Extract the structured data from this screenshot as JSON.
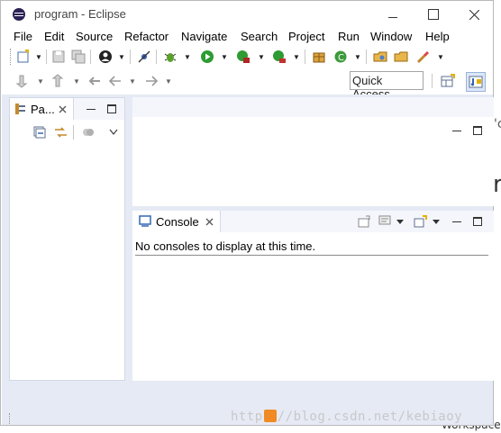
{
  "window": {
    "title": "program - Eclipse"
  },
  "menu": [
    "File",
    "Edit",
    "Source",
    "Refactor",
    "Navigate",
    "Search",
    "Project",
    "Run",
    "Window",
    "Help"
  ],
  "toolbar": {
    "quick_access": "Quick Access"
  },
  "left_view": {
    "tab_label": "Pa..."
  },
  "console": {
    "tab_label": "Console",
    "message": "No consoles to display at this time."
  },
  "background": {
    "watermark_prefix": "http",
    "watermark_suffix": "//blog.csdn.net/kebiaoy",
    "right_text_1": "'c",
    "right_text_2": "r",
    "right_text_3": "Workspace"
  },
  "colors": {
    "workbench_bg": "#e6eaf5",
    "tab_area_bg": "#f4f6fc",
    "accent": "#2c2255"
  }
}
